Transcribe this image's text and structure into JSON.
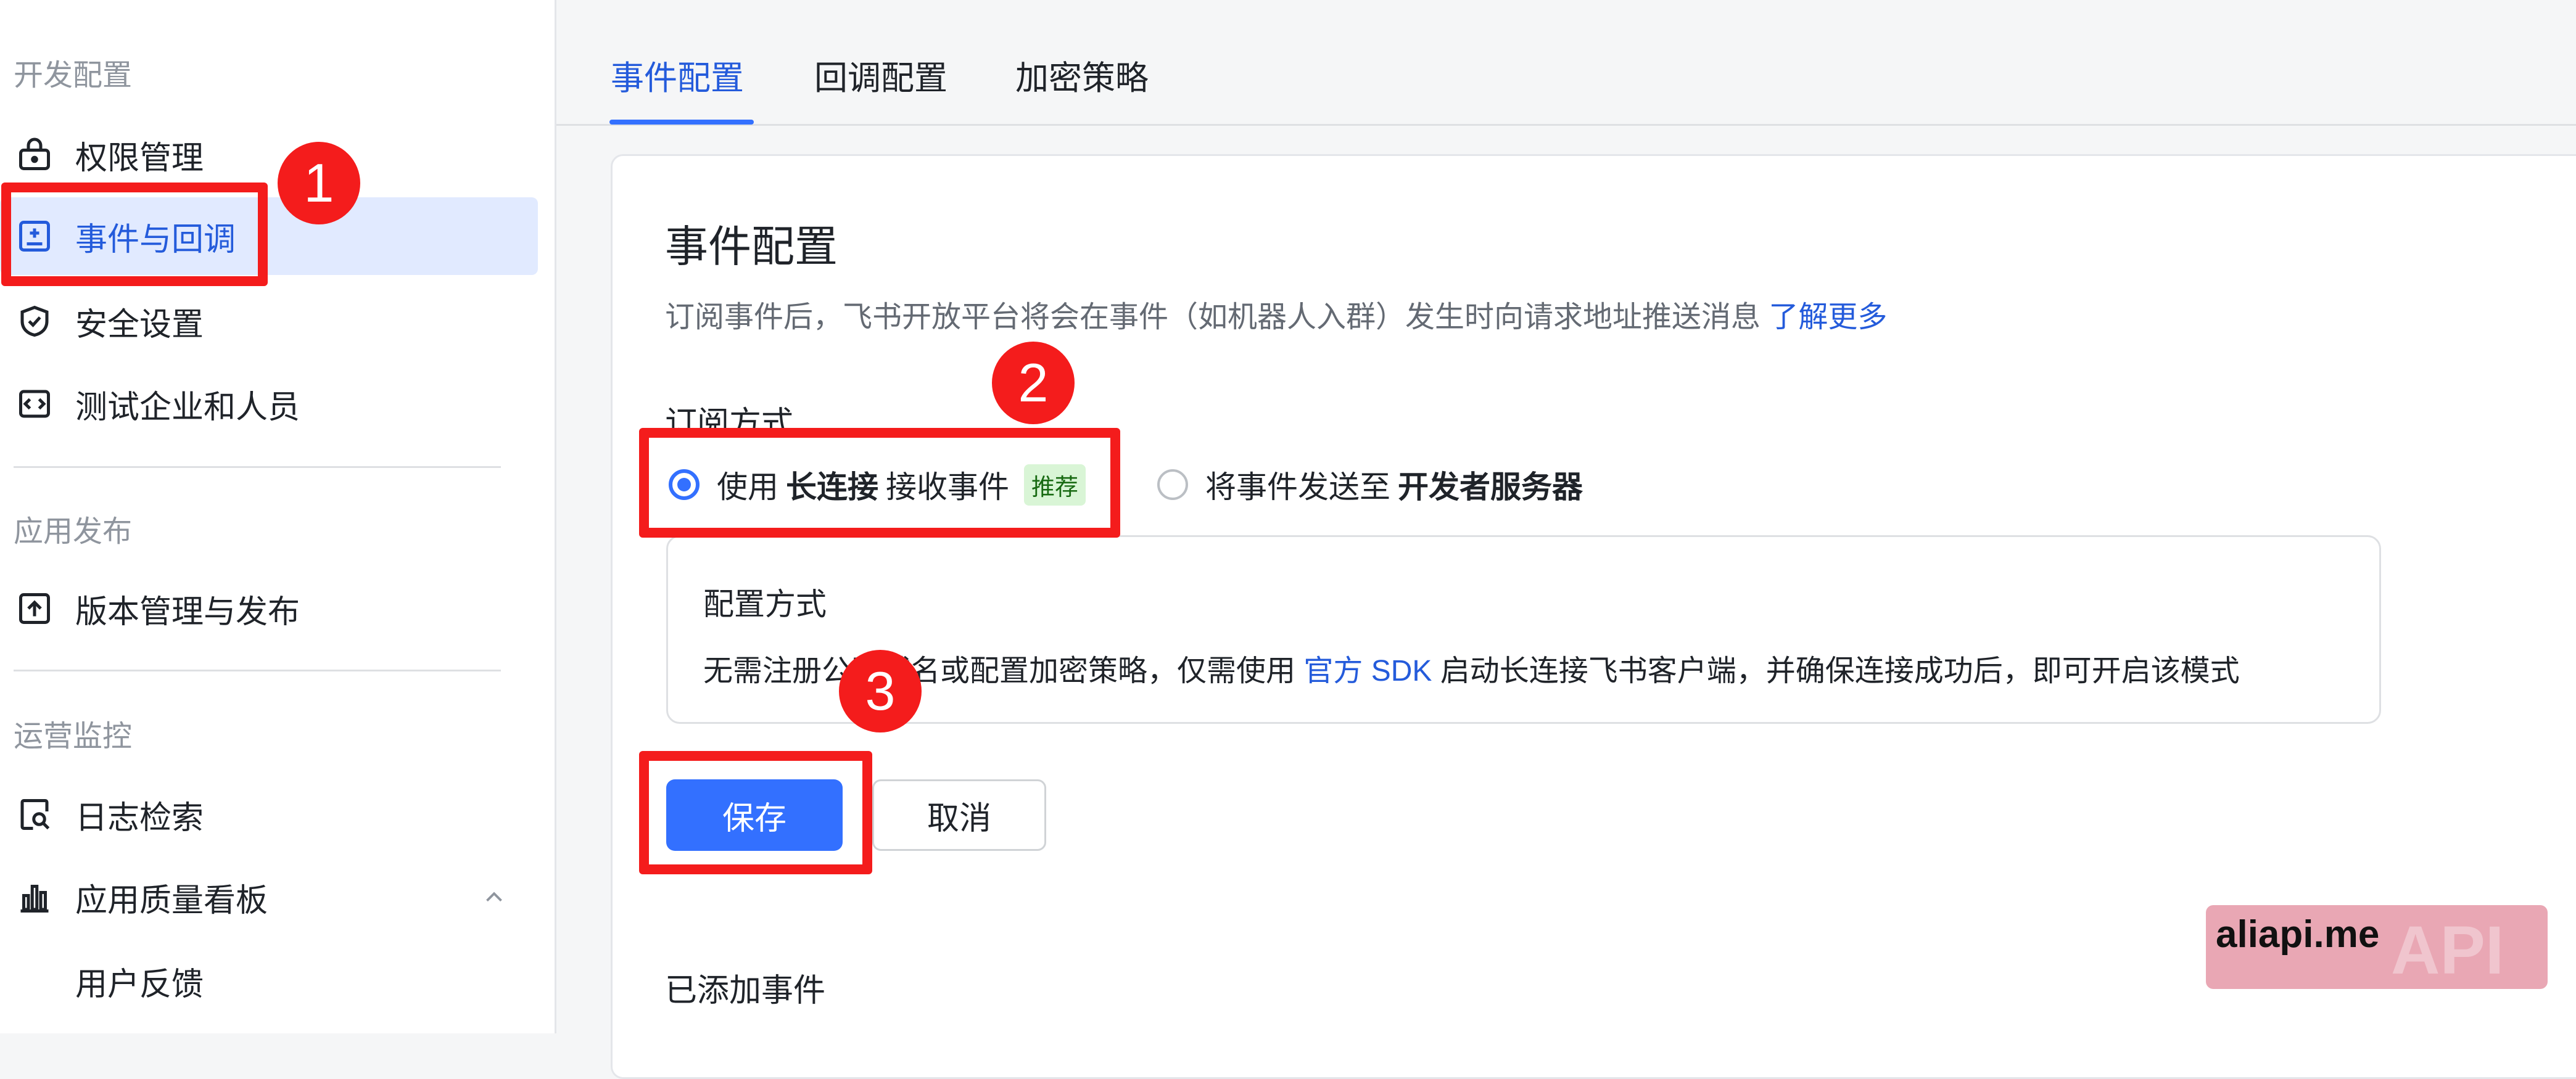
{
  "sidebar": {
    "groups": {
      "dev": "开发配置",
      "publish": "应用发布",
      "ops": "运营监控"
    },
    "items": [
      {
        "label": "权限管理",
        "icon": "lock-icon"
      },
      {
        "label": "事件与回调",
        "icon": "event-callback-icon"
      },
      {
        "label": "安全设置",
        "icon": "shield-check-icon"
      },
      {
        "label": "测试企业和人员",
        "icon": "code-box-icon"
      },
      {
        "label": "版本管理与发布",
        "icon": "upload-box-icon"
      },
      {
        "label": "日志检索",
        "icon": "log-search-icon"
      },
      {
        "label": "应用质量看板",
        "icon": "bar-chart-icon"
      },
      {
        "label": "用户反馈",
        "icon": ""
      }
    ]
  },
  "tabs": [
    {
      "label": "事件配置",
      "active": true
    },
    {
      "label": "回调配置",
      "active": false
    },
    {
      "label": "加密策略",
      "active": false
    }
  ],
  "card": {
    "title": "事件配置",
    "description": "订阅事件后，飞书开放平台将会在事件（如机器人入群）发生时向请求地址推送消息",
    "learn_more": "了解更多",
    "subscribe_label": "订阅方式",
    "options": {
      "long_conn": {
        "pre": "使用",
        "bold": "长连接",
        "post": "接收事件",
        "tag": "推荐",
        "checked": true
      },
      "server": {
        "pre": "将事件发送至",
        "bold": "开发者服务器",
        "checked": false
      }
    },
    "config_box": {
      "title": "配置方式",
      "text_pre": "无需注册公网域名或配置加密策略，仅需使用",
      "link": "官方 SDK",
      "text_post": "启动长连接飞书客户端，并确保连接成功后，即可开启该模式"
    },
    "save_label": "保存",
    "cancel_label": "取消",
    "added_events_label": "已添加事件"
  },
  "annotations": {
    "badge1": "1",
    "badge2": "2",
    "badge3": "3"
  },
  "watermark": {
    "text": "aliapi.me",
    "ghost": "API"
  },
  "colors": {
    "accent": "#3370ff",
    "annotation_red": "#f41c1c",
    "active_bg": "#e1eaff"
  }
}
